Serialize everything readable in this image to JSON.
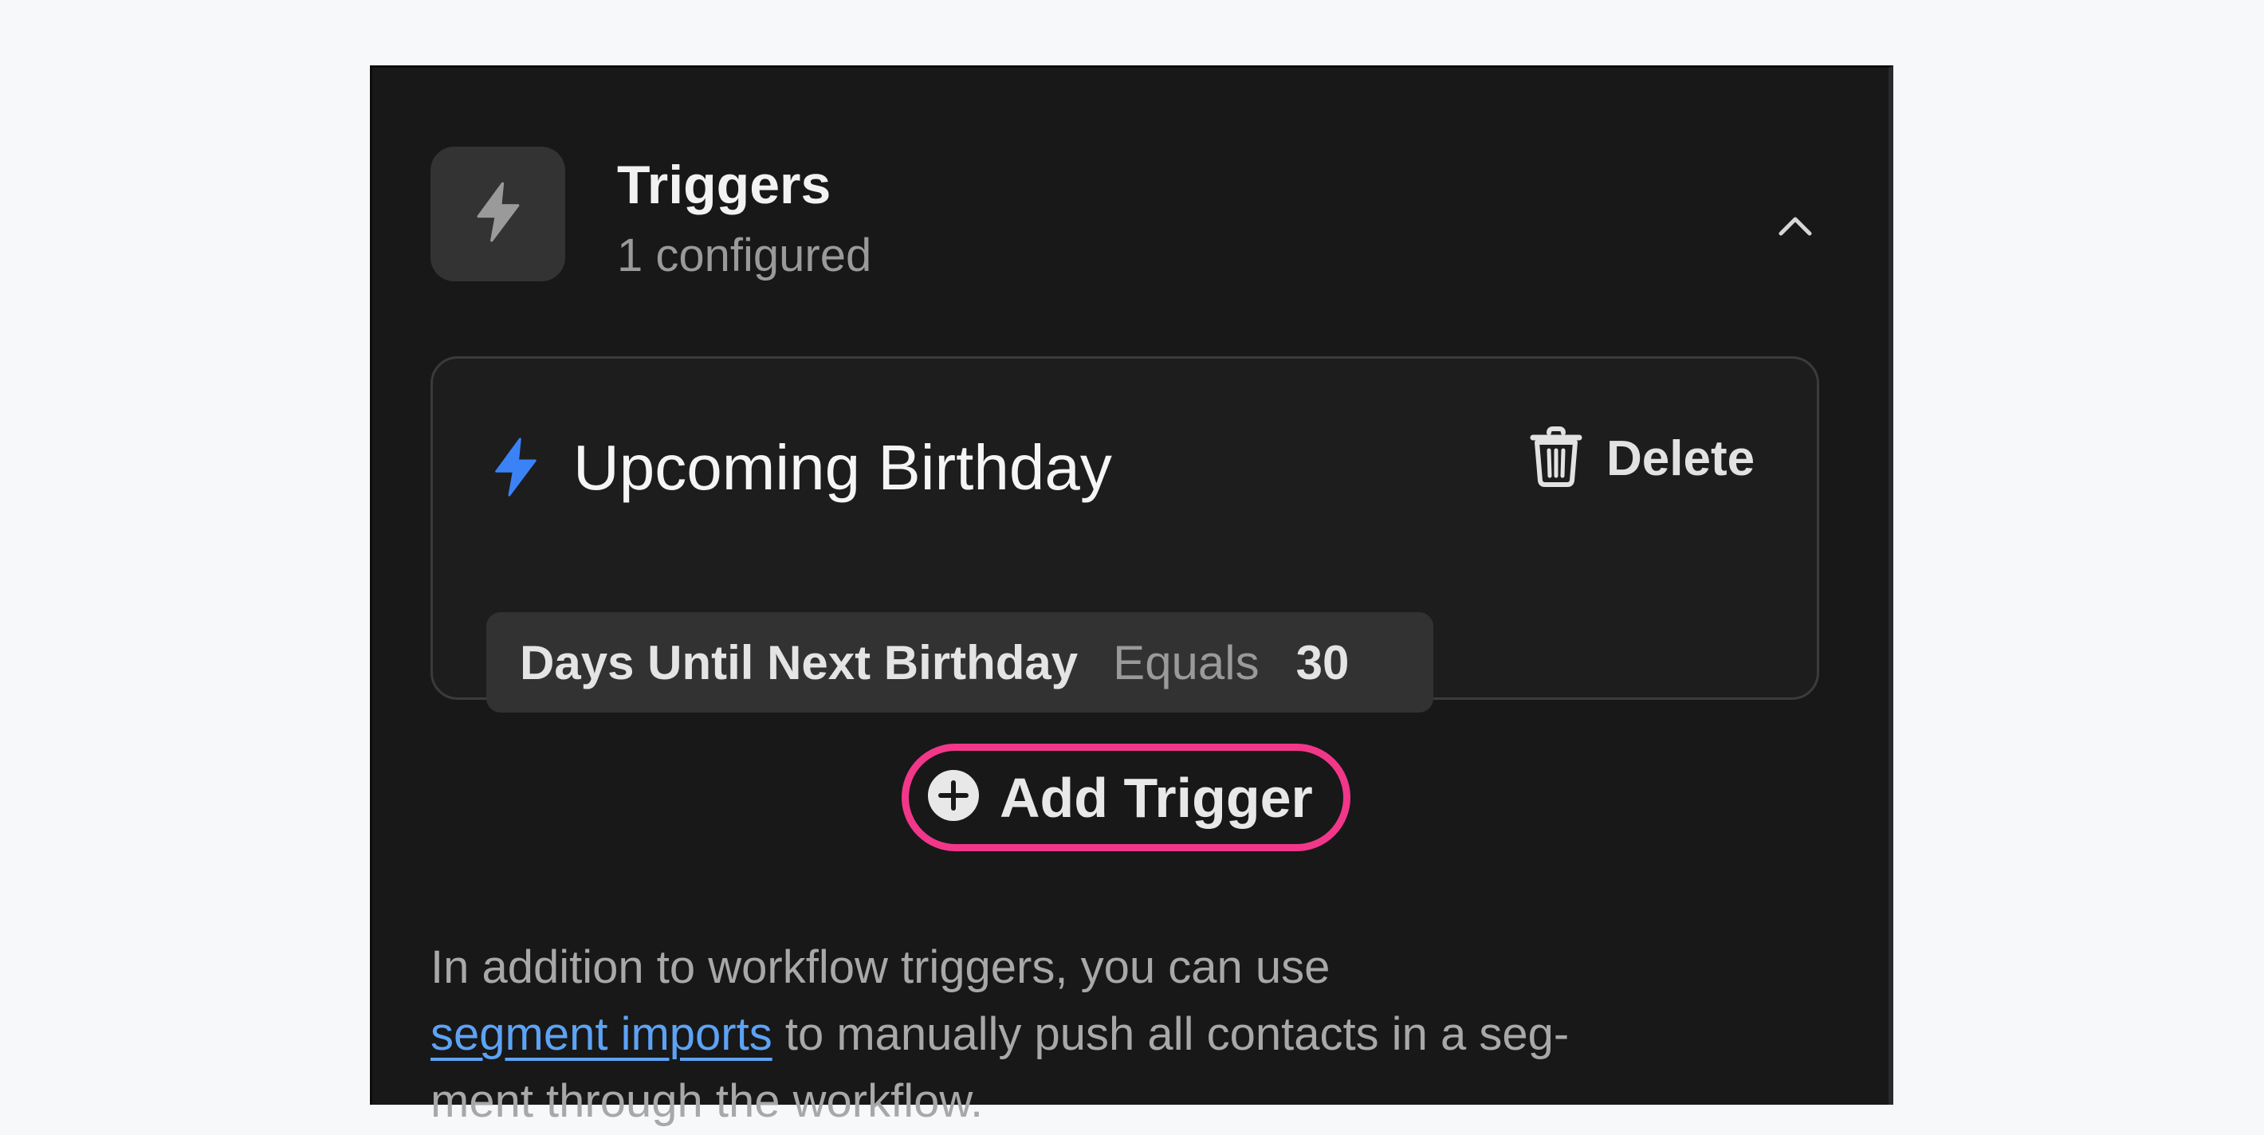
{
  "triggers_section": {
    "title": "Triggers",
    "subtitle": "1 configured",
    "header_icon": "lightning-bolt-icon",
    "collapse_icon": "chevron-up-icon"
  },
  "trigger_card": {
    "name": "Upcoming Birthday",
    "icon": "lightning-bolt-icon",
    "icon_color": "#3b82f6",
    "delete_label": "Delete",
    "delete_icon": "trash-icon",
    "condition": {
      "field": "Days Until Next Birthday",
      "operator": "Equals",
      "value": "30"
    }
  },
  "add_trigger": {
    "label": "Add Trigger",
    "icon": "plus-circle-icon",
    "highlight_color": "#f2378a"
  },
  "helper_text": {
    "line1": "In addition to workflow triggers, you can use",
    "link": "segment imports",
    "line2_rest": " to manually push all contacts in a seg-",
    "line3": "ment through the workflow."
  },
  "colors": {
    "page_background": "#f7f8fa",
    "panel_background": "#181818",
    "link": "#5da3f5"
  }
}
